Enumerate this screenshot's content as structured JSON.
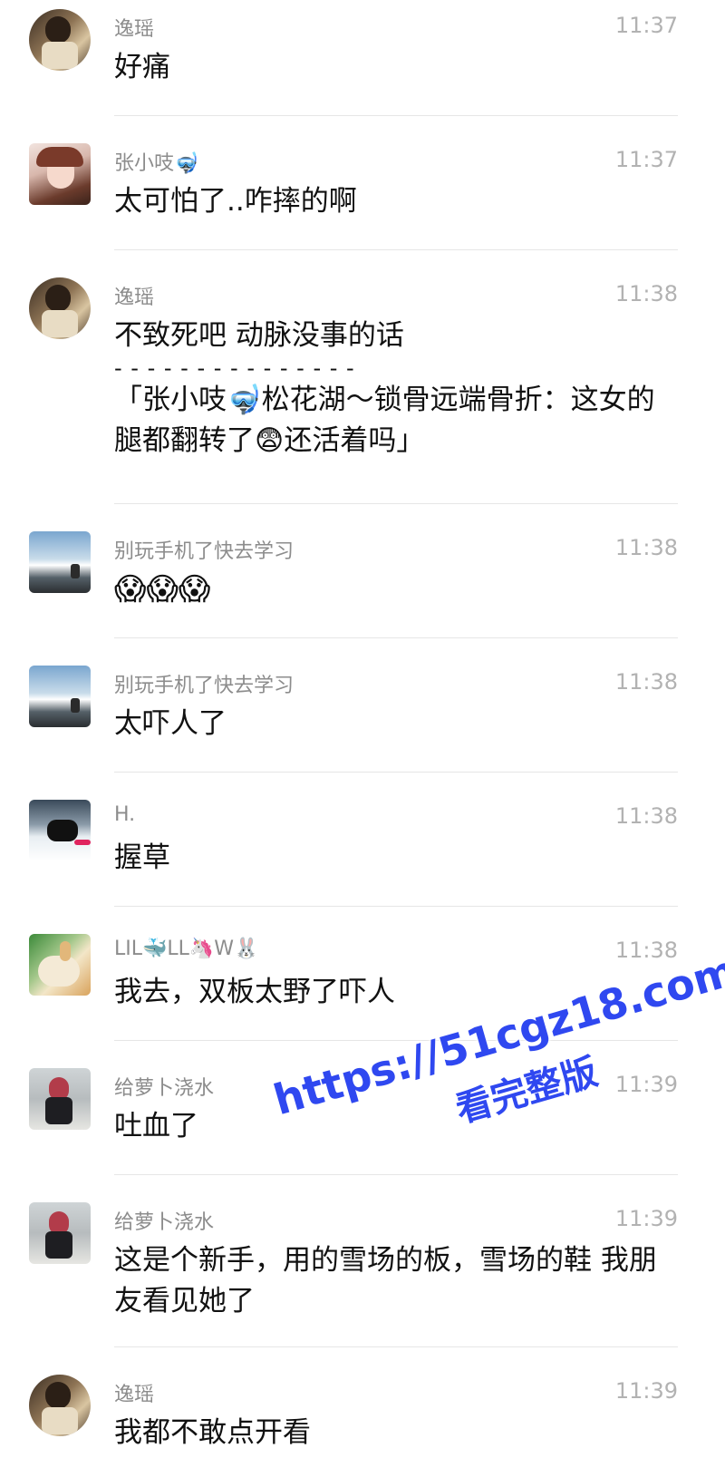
{
  "messages": [
    {
      "name": "逸瑶",
      "time": "11:37",
      "text": "好痛"
    },
    {
      "name": "张小吱🤿",
      "time": "11:37",
      "text": "太可怕了..咋摔的啊"
    },
    {
      "name": "逸瑶",
      "time": "11:38",
      "text": "不致死吧  动脉没事的话",
      "separator": "- - - - - - - - - - - - - - -",
      "quote": "「张小吱🤿松花湖～锁骨远端骨折：这女的腿都翻转了😨还活着吗」"
    },
    {
      "name": "别玩手机了快去学习",
      "time": "11:38",
      "text": "😱😱😱"
    },
    {
      "name": "别玩手机了快去学习",
      "time": "11:38",
      "text": "太吓人了"
    },
    {
      "name": "H.",
      "time": "11:38",
      "text": "握草"
    },
    {
      "name": "LIL🐳LL🦄W🐰",
      "time": "11:38",
      "text": "我去，双板太野了吓人"
    },
    {
      "name": "给萝卜浇水",
      "time": "11:39",
      "text": "吐血了"
    },
    {
      "name": "给萝卜浇水",
      "time": "11:39",
      "text": "这是个新手，用的雪场的板，雪场的鞋 我朋友看见她了"
    },
    {
      "name": "逸瑶",
      "time": "11:39",
      "text": "我都不敢点开看"
    }
  ],
  "watermark": {
    "line1": "https://51cgz18.com",
    "line2": "看完整版"
  }
}
